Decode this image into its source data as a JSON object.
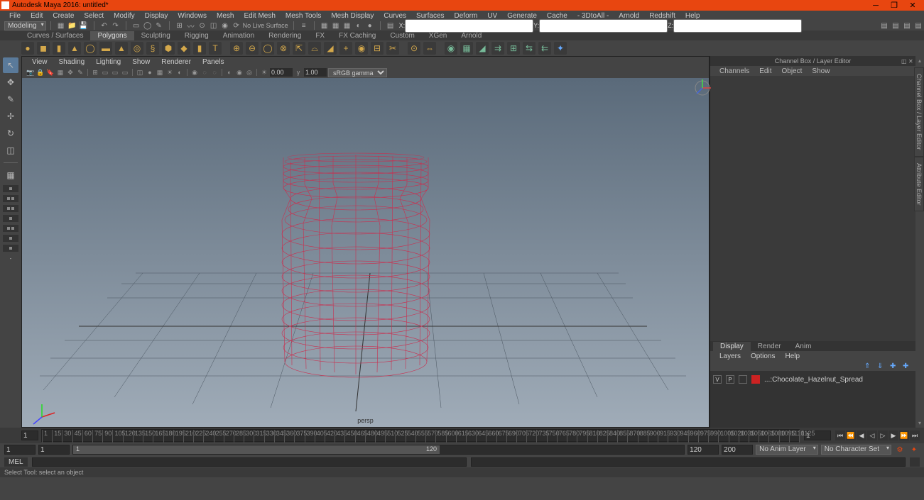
{
  "window": {
    "title": "Autodesk Maya 2016: untitled*"
  },
  "menus": [
    "File",
    "Edit",
    "Create",
    "Select",
    "Modify",
    "Display",
    "Windows",
    "Mesh",
    "Edit Mesh",
    "Mesh Tools",
    "Mesh Display",
    "Curves",
    "Surfaces",
    "Deform",
    "UV",
    "Generate",
    "Cache",
    "- 3DtoAll -",
    "Arnold",
    "Redshift",
    "Help"
  ],
  "mode": "Modeling",
  "status": {
    "x": "",
    "y": "",
    "z": "",
    "no_live": "No Live Surface"
  },
  "shelf_tabs": [
    "Curves / Surfaces",
    "Polygons",
    "Sculpting",
    "Rigging",
    "Animation",
    "Rendering",
    "FX",
    "FX Caching",
    "Custom",
    "XGen",
    "Arnold"
  ],
  "panel_menus": [
    "View",
    "Shading",
    "Lighting",
    "Show",
    "Renderer",
    "Panels"
  ],
  "panel_fields": {
    "exposure": "0.00",
    "gamma": "1.00",
    "color_space": "sRGB gamma"
  },
  "view": {
    "label": "persp"
  },
  "channel_box": {
    "title": "Channel Box / Layer Editor",
    "menus": [
      "Channels",
      "Edit",
      "Object",
      "Show"
    ]
  },
  "layer_editor": {
    "tabs": [
      "Display",
      "Render",
      "Anim"
    ],
    "menus": [
      "Layers",
      "Options",
      "Help"
    ],
    "layer": {
      "v": "V",
      "p": "P",
      "name": "...:Chocolate_Hazelnut_Spread"
    }
  },
  "right_sidetabs": [
    "Channel Box / Layer Editor",
    "Attribute Editor"
  ],
  "timeline": {
    "ticks": [
      "1",
      "15",
      "30",
      "45",
      "60",
      "75",
      "90",
      "105",
      "120",
      "135",
      "150",
      "165",
      "180",
      "195",
      "210",
      "225",
      "240",
      "255",
      "270",
      "285",
      "300",
      "315",
      "330",
      "345",
      "360",
      "375",
      "390",
      "405",
      "420",
      "435",
      "450",
      "465",
      "480",
      "495",
      "510",
      "525",
      "540",
      "555",
      "570",
      "585",
      "600",
      "615",
      "630",
      "645",
      "660",
      "675",
      "690",
      "705",
      "720",
      "735",
      "750",
      "765",
      "780",
      "795",
      "810",
      "825",
      "840",
      "855",
      "870",
      "885",
      "900",
      "915",
      "930",
      "945",
      "960",
      "975",
      "990",
      "1005",
      "1020",
      "1035",
      "1050",
      "1065",
      "1080",
      "1095",
      "1110",
      "1125"
    ],
    "current": "1"
  },
  "range": {
    "start": "1",
    "in": "1",
    "in_inner": "1",
    "out_inner": "120",
    "out": "120",
    "end": "200",
    "anim_layer": "No Anim Layer",
    "char_set": "No Character Set"
  },
  "cmd": {
    "lang": "MEL",
    "value": ""
  },
  "help": "Select Tool: select an object"
}
